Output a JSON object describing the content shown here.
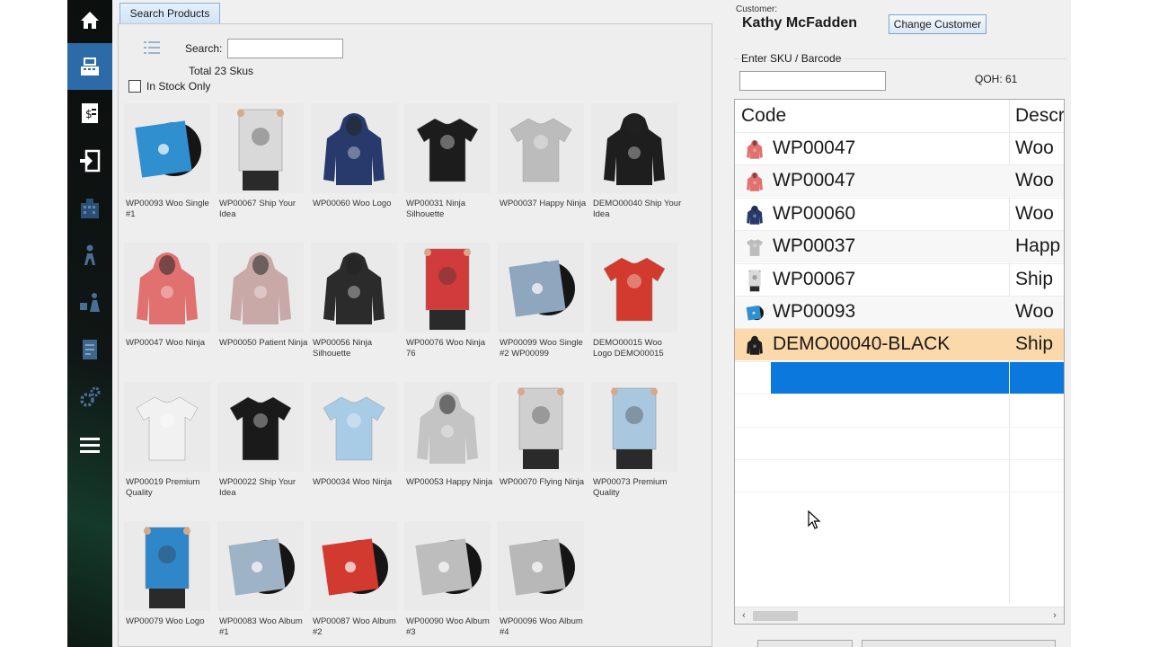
{
  "search_tab": {
    "label": "Search Products"
  },
  "search": {
    "label": "Search:",
    "value": "",
    "total": "Total 23 Skus",
    "in_stock_label": "In Stock Only",
    "in_stock_checked": false
  },
  "products": [
    {
      "label": "WP00093 Woo Single #1",
      "kind": "vinyl",
      "color": "#2f8fcf"
    },
    {
      "label": "WP00067 Ship Your Idea",
      "kind": "poster",
      "color": "#d9d9d9"
    },
    {
      "label": "WP00060 Woo Logo",
      "kind": "hoodie",
      "color": "#283a6b"
    },
    {
      "label": "WP00031 Ninja Silhouette",
      "kind": "tshirt",
      "color": "#1c1c1c"
    },
    {
      "label": "WP00037 Happy Ninja",
      "kind": "tshirt",
      "color": "#bcbcbc"
    },
    {
      "label": "DEMO00040 Ship Your Idea",
      "kind": "hoodie",
      "color": "#1e1e1e"
    },
    {
      "label": "WP00047 Woo Ninja",
      "kind": "hoodie",
      "color": "#e0716f"
    },
    {
      "label": "WP00050 Patient Ninja",
      "kind": "hoodie",
      "color": "#c9a9a8"
    },
    {
      "label": "WP00056 Ninja Silhouette",
      "kind": "hoodie",
      "color": "#2b2b2b"
    },
    {
      "label": "WP00076 Woo Ninja 76",
      "kind": "poster",
      "color": "#d23b3b"
    },
    {
      "label": "WP00099 Woo Single #2 WP00099",
      "kind": "vinyl",
      "color": "#8fa6bf"
    },
    {
      "label": "DEMO00015 Woo Logo DEMO00015",
      "kind": "tshirt",
      "color": "#d23a2d"
    },
    {
      "label": "WP00019 Premium Quality",
      "kind": "tshirt",
      "color": "#f1f1f1"
    },
    {
      "label": "WP00022 Ship Your Idea",
      "kind": "tshirt",
      "color": "#1a1a1a"
    },
    {
      "label": "WP00034 Woo Ninja",
      "kind": "tshirt",
      "color": "#a8cbe6"
    },
    {
      "label": "WP00053 Happy Ninja",
      "kind": "hoodie",
      "color": "#c4c4c4"
    },
    {
      "label": "WP00070 Flying Ninja",
      "kind": "poster",
      "color": "#cfcfcf"
    },
    {
      "label": "WP00073 Premium Quality",
      "kind": "poster",
      "color": "#a9c8df"
    },
    {
      "label": "WP00079 Woo Logo",
      "kind": "poster",
      "color": "#2f86c9"
    },
    {
      "label": "WP00083 Woo Album #1",
      "kind": "vinyl",
      "color": "#9fb3c6"
    },
    {
      "label": "WP00087 Woo Album #2",
      "kind": "vinyl",
      "color": "#d33a2f"
    },
    {
      "label": "WP00090 Woo Album #3",
      "kind": "vinyl",
      "color": "#bdbdbd"
    },
    {
      "label": "WP00096 Woo Album #4",
      "kind": "vinyl",
      "color": "#b8b8b8"
    }
  ],
  "customer": {
    "caption": "Customer:",
    "name": "Kathy McFadden",
    "change_label": "Change Customer"
  },
  "sku": {
    "label": "Enter SKU / Barcode",
    "value": "",
    "qoh": "QOH: 61"
  },
  "cart": {
    "headers": {
      "code": "Code",
      "desc": "Descr"
    },
    "rows": [
      {
        "code": "WP00047",
        "desc": "Woo",
        "icon": "hoodie",
        "color": "#e0716f",
        "selected": false
      },
      {
        "code": "WP00047",
        "desc": "Woo",
        "icon": "hoodie",
        "color": "#e0716f",
        "selected": false
      },
      {
        "code": "WP00060",
        "desc": "Woo",
        "icon": "hoodie",
        "color": "#283a6b",
        "selected": false
      },
      {
        "code": "WP00037",
        "desc": "Happ",
        "icon": "tshirt",
        "color": "#bcbcbc",
        "selected": false
      },
      {
        "code": "WP00067",
        "desc": "Ship",
        "icon": "poster",
        "color": "#d9d9d9",
        "selected": false
      },
      {
        "code": "WP00093",
        "desc": "Woo",
        "icon": "vinyl",
        "color": "#2f8fcf",
        "selected": false
      },
      {
        "code": "DEMO00040-BLACK",
        "desc": "Ship",
        "icon": "hoodie",
        "color": "#1e1e1e",
        "selected": true
      }
    ]
  },
  "sidebar": {
    "items": [
      {
        "icon": "home-icon",
        "active": false
      },
      {
        "icon": "cash-register-icon",
        "active": true
      },
      {
        "icon": "invoice-icon",
        "active": false
      },
      {
        "icon": "sign-in-icon",
        "active": false
      },
      {
        "icon": "building-icon",
        "active": false
      },
      {
        "icon": "person-icon",
        "active": false
      },
      {
        "icon": "dolly-icon",
        "active": false
      },
      {
        "icon": "report-icon",
        "active": false
      },
      {
        "icon": "gears-icon",
        "active": false
      },
      {
        "icon": "menu-icon",
        "active": false
      }
    ]
  },
  "colors": {
    "accent": "#2d6aa8",
    "selection": "#fbd9aa",
    "new_row": "#0a78dc"
  }
}
